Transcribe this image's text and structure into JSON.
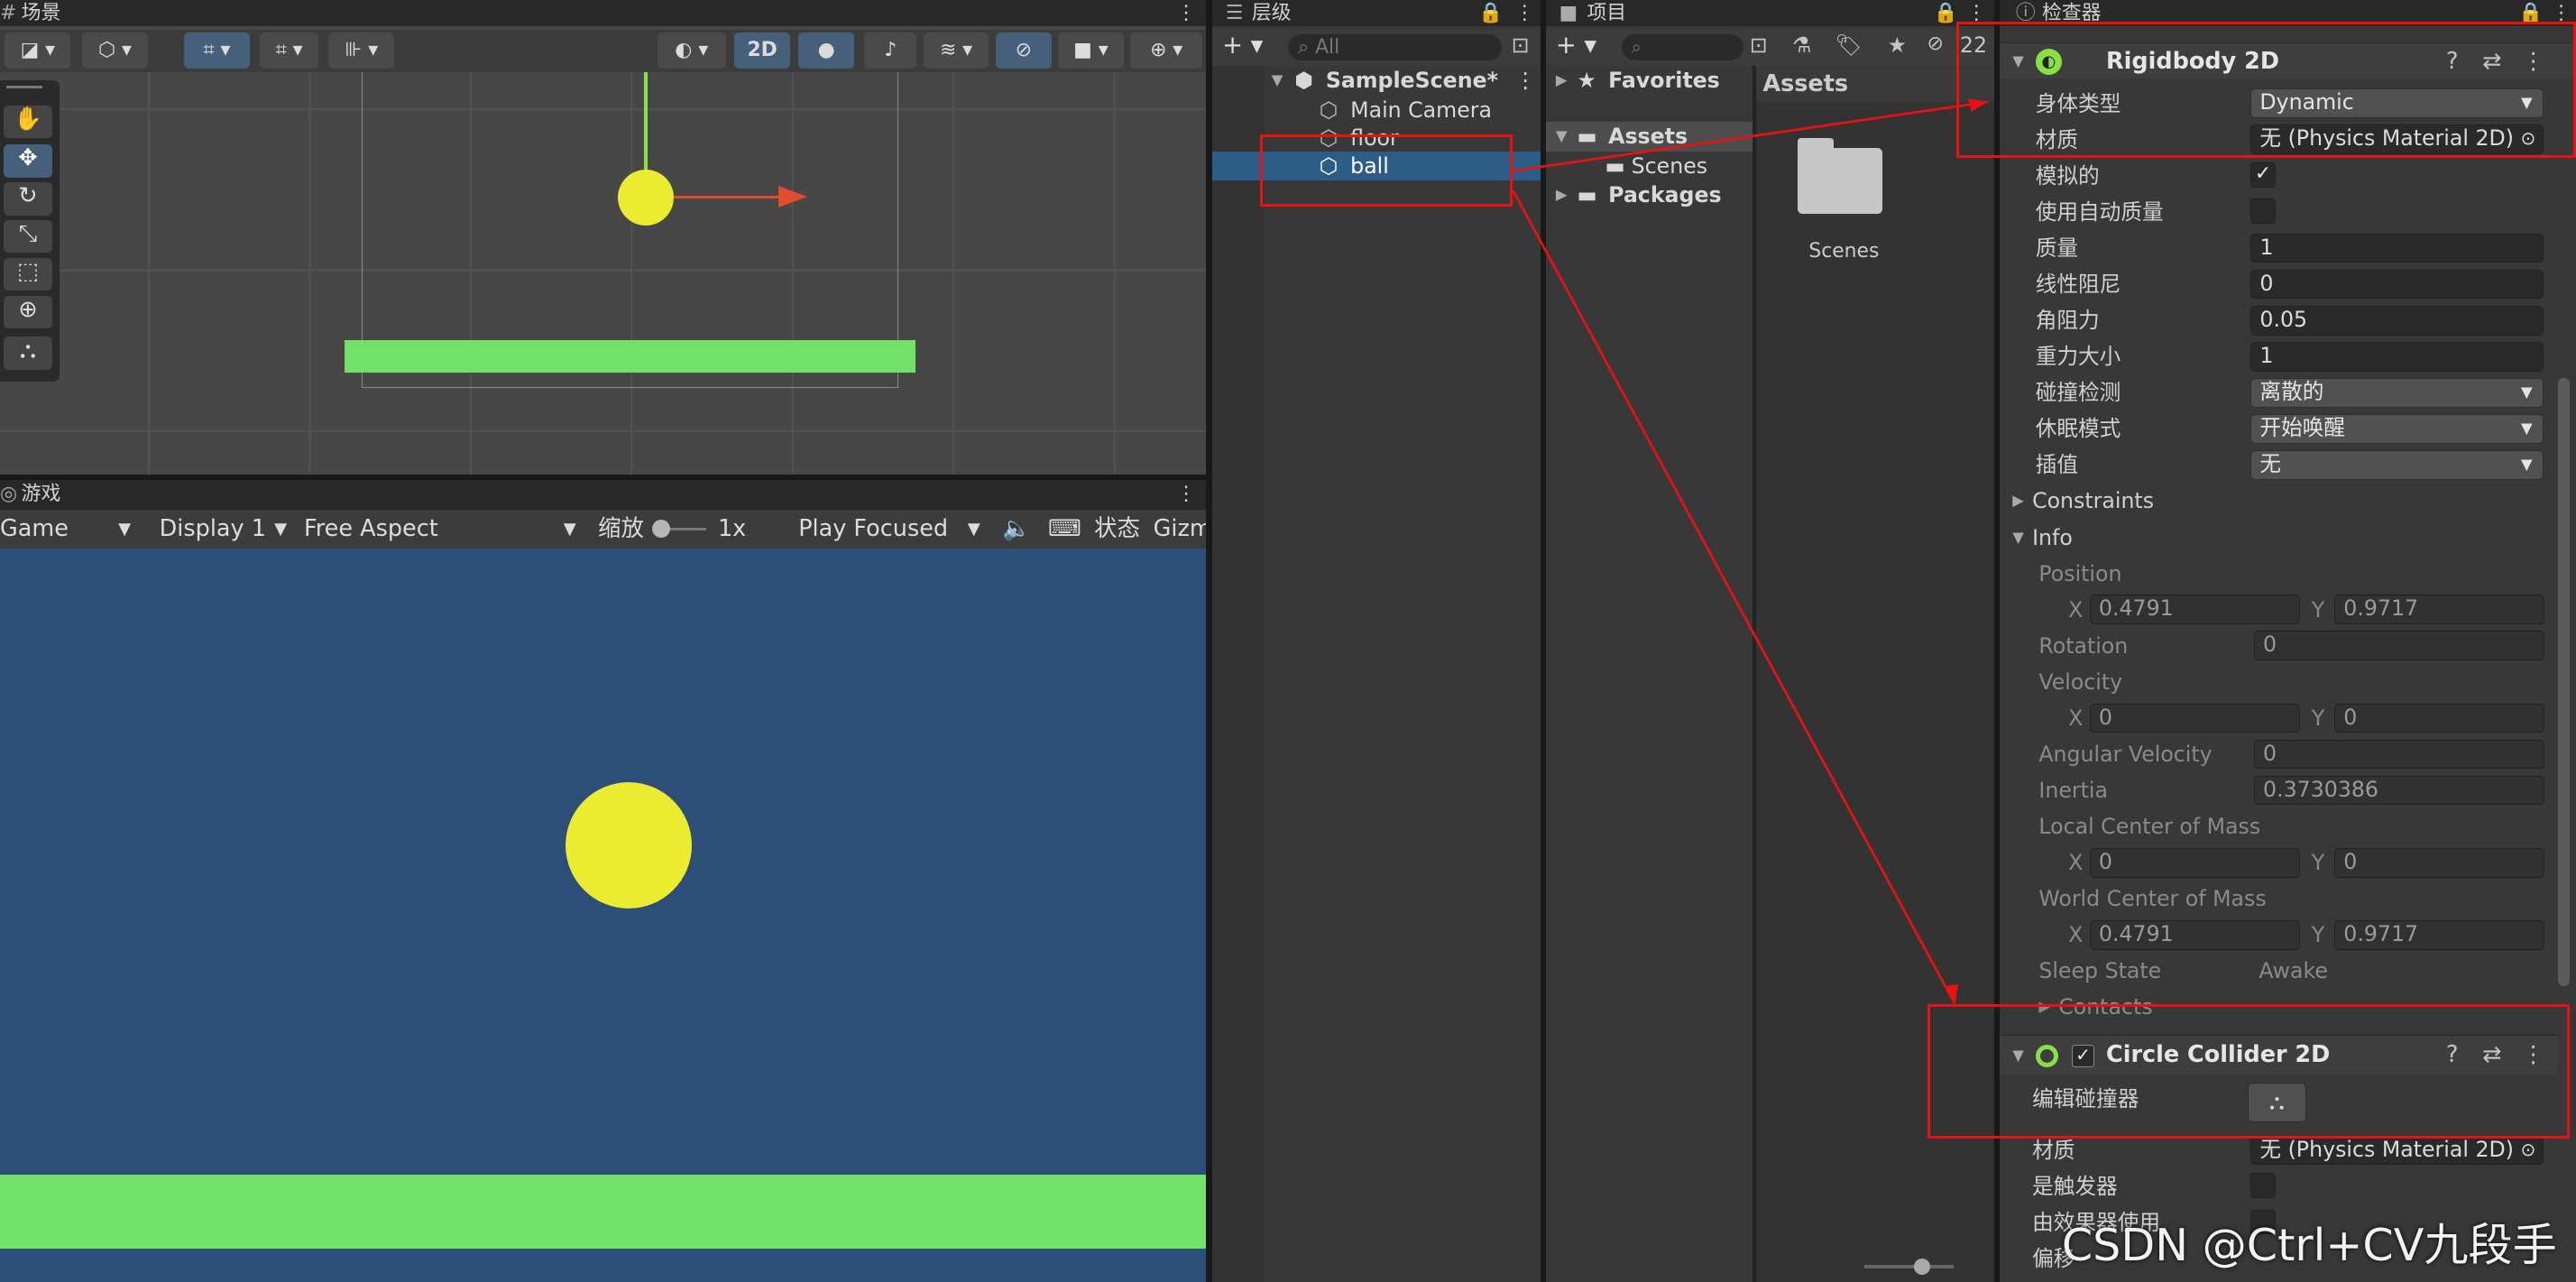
{
  "scene": {
    "tab_label": "场景",
    "toolbar": {
      "mode_2d": "2D"
    }
  },
  "game": {
    "tab_label": "游戏",
    "view_dropdown": "Game",
    "display_dropdown": "Display 1",
    "aspect_dropdown": "Free Aspect",
    "scale_label": "缩放",
    "scale_value": "1x",
    "play_mode_dropdown": "Play Focused",
    "stats_label": "状态",
    "gizmos_label": "Gizm",
    "colors": {
      "background": "#2e4e7a",
      "ball": "#ebeb2f",
      "floor": "#71e267"
    }
  },
  "hierarchy": {
    "tab_label": "层级",
    "search_placeholder": "All",
    "scene_name": "SampleScene*",
    "items": [
      {
        "label": "Main Camera"
      },
      {
        "label": "floor"
      },
      {
        "label": "ball",
        "selected": true
      }
    ]
  },
  "project": {
    "tab_label": "项目",
    "favorites": "Favorites",
    "assets": "Assets",
    "scenes": "Scenes",
    "packages": "Packages",
    "breadcrumb": "Assets",
    "folder_label": "Scenes",
    "hidden_count": "22"
  },
  "inspector": {
    "tab_label": "检查器",
    "rigidbody": {
      "title": "Rigidbody 2D",
      "fields": [
        {
          "label": "身体类型",
          "value": "Dynamic",
          "kind": "dropdown"
        },
        {
          "label": "材质",
          "value": "无 (Physics Material 2D)",
          "kind": "object"
        },
        {
          "label": "模拟的",
          "value": "✓",
          "kind": "check"
        },
        {
          "label": "使用自动质量",
          "value": "",
          "kind": "check"
        },
        {
          "label": "质量",
          "value": "1",
          "kind": "field"
        },
        {
          "label": "线性阻尼",
          "value": "0",
          "kind": "field"
        },
        {
          "label": "角阻力",
          "value": "0.05",
          "kind": "field"
        },
        {
          "label": "重力大小",
          "value": "1",
          "kind": "field"
        },
        {
          "label": "碰撞检测",
          "value": "离散的",
          "kind": "dropdown"
        },
        {
          "label": "休眠模式",
          "value": "开始唤醒",
          "kind": "dropdown"
        },
        {
          "label": "插值",
          "value": "无",
          "kind": "dropdown"
        }
      ],
      "constraints": "Constraints",
      "info": {
        "label": "Info",
        "position": "Position",
        "position_x": "0.4791",
        "position_y": "0.9717",
        "rotation": "Rotation",
        "rotation_value": "0",
        "velocity": "Velocity",
        "velocity_x": "0",
        "velocity_y": "0",
        "angular_velocity": "Angular Velocity",
        "angular_velocity_value": "0",
        "inertia": "Inertia",
        "inertia_value": "0.3730386",
        "local_com": "Local Center of Mass",
        "local_com_x": "0",
        "local_com_y": "0",
        "world_com": "World Center of Mass",
        "world_com_x": "0.4791",
        "world_com_y": "0.9717",
        "sleep_state": "Sleep State",
        "sleep_state_value": "Awake",
        "contacts": "Contacts",
        "x": "X",
        "y": "Y"
      }
    },
    "collider": {
      "title": "Circle Collider 2D",
      "edit_label": "编辑碰撞器",
      "material_label": "材质",
      "material_value": "无 (Physics Material 2D)",
      "trigger_label": "是触发器",
      "effector_label": "由效果器使用",
      "offset_label": "偏移"
    }
  },
  "watermark": "CSDN @Ctrl+CV九段手"
}
